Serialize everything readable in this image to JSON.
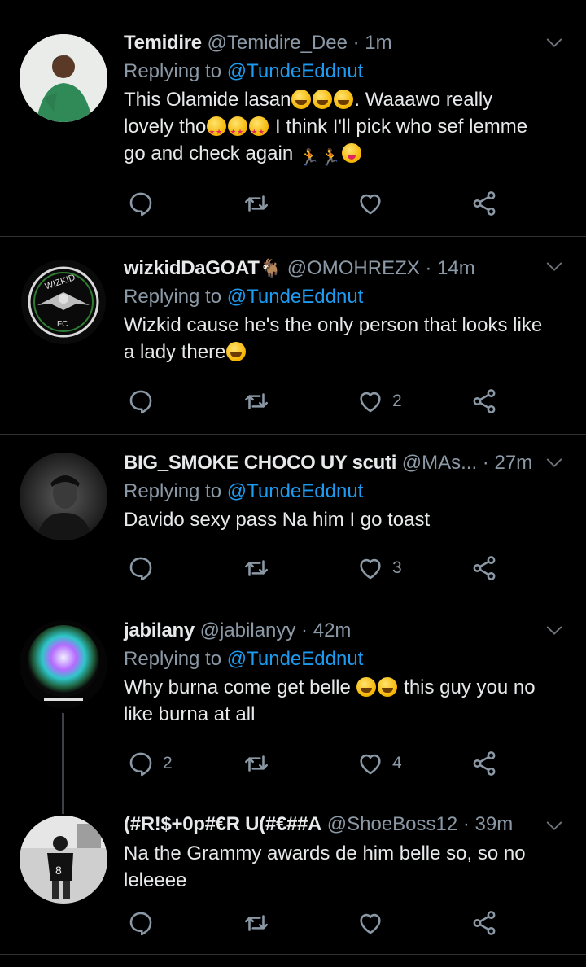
{
  "icons": {
    "reply": "reply-icon",
    "retweet": "retweet-icon",
    "like": "heart-icon",
    "share": "share-icon",
    "more": "chevron-down-icon"
  },
  "colors": {
    "background": "#000000",
    "mention": "#1d9bf0",
    "secondary": "#8b98a5",
    "divider": "#2f3336"
  },
  "tweets": [
    {
      "name": "Temidire",
      "handle": "@Temidire_Dee",
      "time": "1m",
      "reply_prefix": "Replying to",
      "reply_to": "@TundeEddnut",
      "text_1": "This Olamide lasan",
      "text_2": ". Waaawo really",
      "text_3": "lovely tho",
      "text_4": " I think I'll pick who sef lemme",
      "text_5": "go and check again ",
      "replies": "",
      "likes": ""
    },
    {
      "name": "wizkidDaGOAT",
      "handle": "@OMOHREZX",
      "time": "14m",
      "reply_prefix": "Replying to",
      "reply_to": "@TundeEddnut",
      "text_1": "Wizkid cause he's the only person that looks like",
      "text_2": "a lady there",
      "replies": "",
      "likes": "2"
    },
    {
      "name": "BIG_SMOKE CHOCO UY scuti",
      "handle": "@MAs...",
      "time": "27m",
      "reply_prefix": "Replying to",
      "reply_to": "@TundeEddnut",
      "text_1": "Davido sexy pass Na him I go toast",
      "replies": "",
      "likes": "3"
    },
    {
      "name": "jabilany",
      "handle": "@jabilanyy",
      "time": "42m",
      "reply_prefix": "Replying to",
      "reply_to": "@TundeEddnut",
      "text_1": "Why burna come get belle ",
      "text_2": " this guy you no",
      "text_3": "like burna at all",
      "replies": "2",
      "likes": "4"
    },
    {
      "name": "(#R!$+0p#€R U(#€##A",
      "handle": "@ShoeBoss12",
      "time": "39m",
      "text_1": "Na the Grammy awards de him belle so, so no",
      "text_2": "leleeee",
      "replies": "",
      "likes": ""
    }
  ],
  "sep": " · "
}
